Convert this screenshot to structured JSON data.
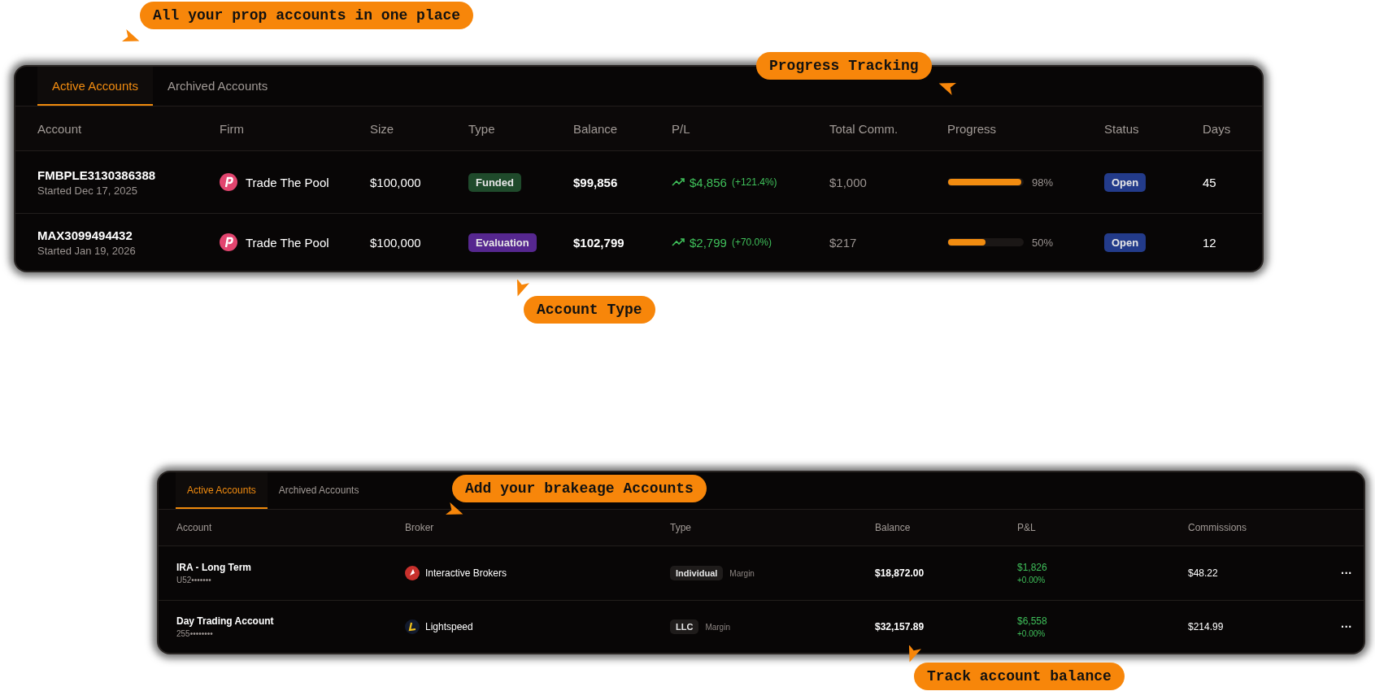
{
  "callouts": [
    {
      "text": "All your prop accounts in one place"
    },
    {
      "text": "Progress Tracking"
    },
    {
      "text": "Account Type"
    },
    {
      "text": "Add your brakeage Accounts"
    },
    {
      "text": "Track account balance"
    }
  ],
  "prop_panel": {
    "tabs": [
      {
        "label": "Active Accounts",
        "selected": true
      },
      {
        "label": "Archived Accounts",
        "selected": false
      }
    ],
    "columns": [
      "Account",
      "Firm",
      "Size",
      "Type",
      "Balance",
      "P/L",
      "Total Comm.",
      "Progress",
      "Status",
      "Days"
    ],
    "rows": [
      {
        "account": "FMBPLE3130386388",
        "started": "Started Dec 17, 2025",
        "firm": "Trade The Pool",
        "size": "$100,000",
        "type": {
          "label": "Funded",
          "color": "#1f4a2b"
        },
        "balance": "$99,856",
        "pl": "$4,856",
        "pl_pct": "(+121.4%)",
        "commission": "$1,000",
        "level": 0.98,
        "progress": "98%",
        "status": "Open",
        "days": "45"
      },
      {
        "account": "MAX3099494432",
        "started": "Started Jan 19, 2026",
        "firm": "Trade The Pool",
        "size": "$100,000",
        "type": {
          "label": "Evaluation",
          "color": "#56278f"
        },
        "balance": "$102,799",
        "pl": "$2,799",
        "pl_pct": "(+70.0%)",
        "commission": "$217",
        "level": 0.5,
        "progress": "50%",
        "status": "Open",
        "days": "12"
      }
    ]
  },
  "broker_panel": {
    "tabs": [
      {
        "label": "Active Accounts",
        "selected": true
      },
      {
        "label": "Archived Accounts",
        "selected": false
      }
    ],
    "columns": [
      "Account",
      "Broker",
      "Type",
      "Balance",
      "P&L",
      "Commissions"
    ],
    "rows": [
      {
        "account": "IRA - Long Term",
        "number": "U52•••••••",
        "broker": "Interactive Brokers",
        "type": "Individual",
        "margin": "Margin",
        "balance": "$18,872.00",
        "pl": "$1,826",
        "pl_pct": "+0.00%",
        "commission": "$48.22",
        "menu": "···"
      },
      {
        "account": "Day Trading Account",
        "number": "255••••••••",
        "broker": "Lightspeed",
        "type": "LLC",
        "margin": "Margin",
        "balance": "$32,157.89",
        "pl": "$6,558",
        "pl_pct": "+0.00%",
        "commission": "$214.99",
        "menu": "···"
      }
    ]
  }
}
